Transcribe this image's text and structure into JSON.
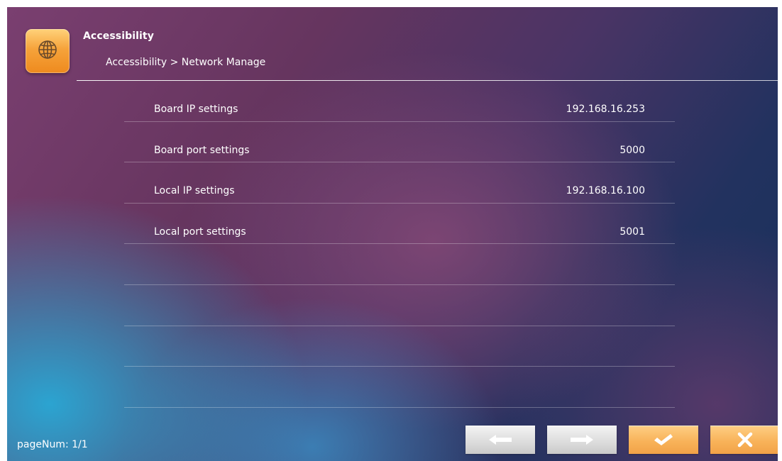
{
  "header": {
    "title": "Accessibility",
    "breadcrumb": "Accessibility > Network Manage",
    "icon": "globe-icon"
  },
  "settings": [
    {
      "label": "Board IP settings",
      "value": "192.168.16.253"
    },
    {
      "label": "Board port settings",
      "value": "5000"
    },
    {
      "label": "Local IP settings",
      "value": "192.168.16.100"
    },
    {
      "label": "Local port settings",
      "value": "5001"
    },
    {
      "label": "",
      "value": ""
    },
    {
      "label": "",
      "value": ""
    },
    {
      "label": "",
      "value": ""
    },
    {
      "label": "",
      "value": ""
    }
  ],
  "footer": {
    "page_num": "pageNum: 1/1",
    "buttons": [
      {
        "icon": "arrow-left-icon"
      },
      {
        "icon": "arrow-right-icon"
      },
      {
        "icon": "check-icon"
      },
      {
        "icon": "close-icon"
      }
    ]
  },
  "colors": {
    "accent_orange": "#f6a33b",
    "button_gray": "#dcdcdc"
  }
}
